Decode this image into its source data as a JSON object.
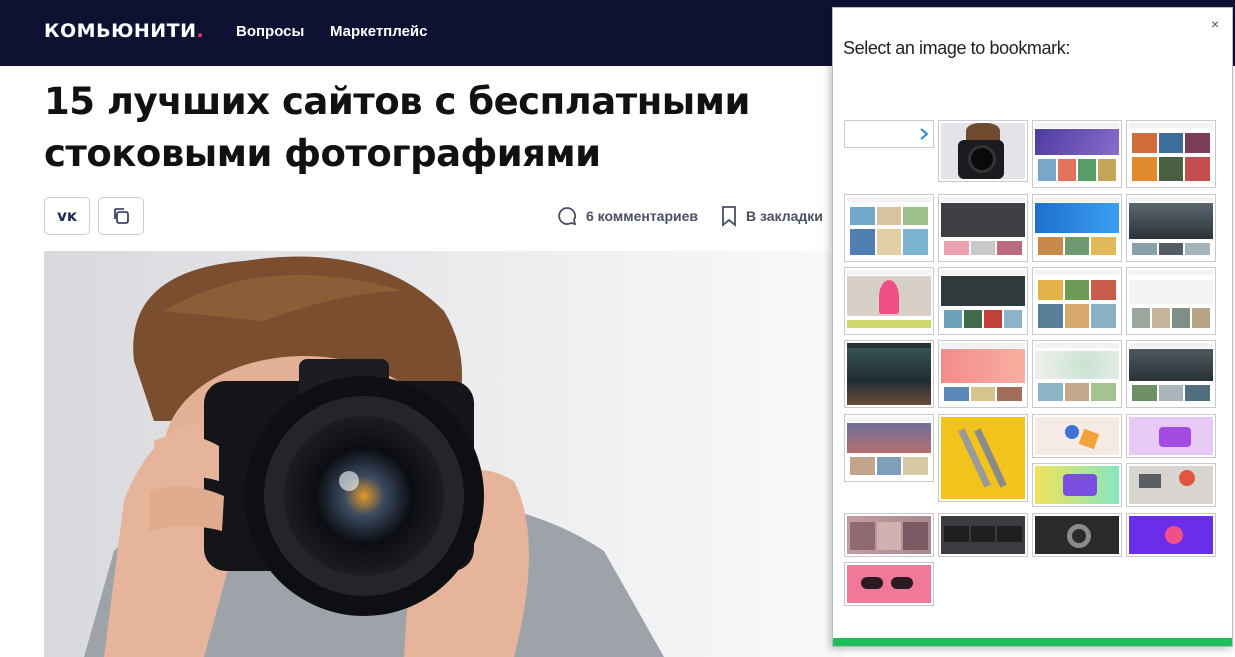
{
  "header": {
    "logo_text": "КОМЬЮНИТИ",
    "logo_dot": ".",
    "nav": [
      "Вопросы",
      "Маркетплейс"
    ]
  },
  "article": {
    "title_line1": "15 лучших сайтов с бесплатными",
    "title_line2": "стоковыми фотографиями",
    "share_vk": "VK",
    "comments": "6 комментариев",
    "bookmark": "В закладки"
  },
  "panel": {
    "title": "Select an image to bookmark:",
    "close": "×"
  },
  "colors": {
    "header_bg": "#0f1133",
    "accent": "#ff2d6b",
    "progress": "#1dbf5a"
  }
}
